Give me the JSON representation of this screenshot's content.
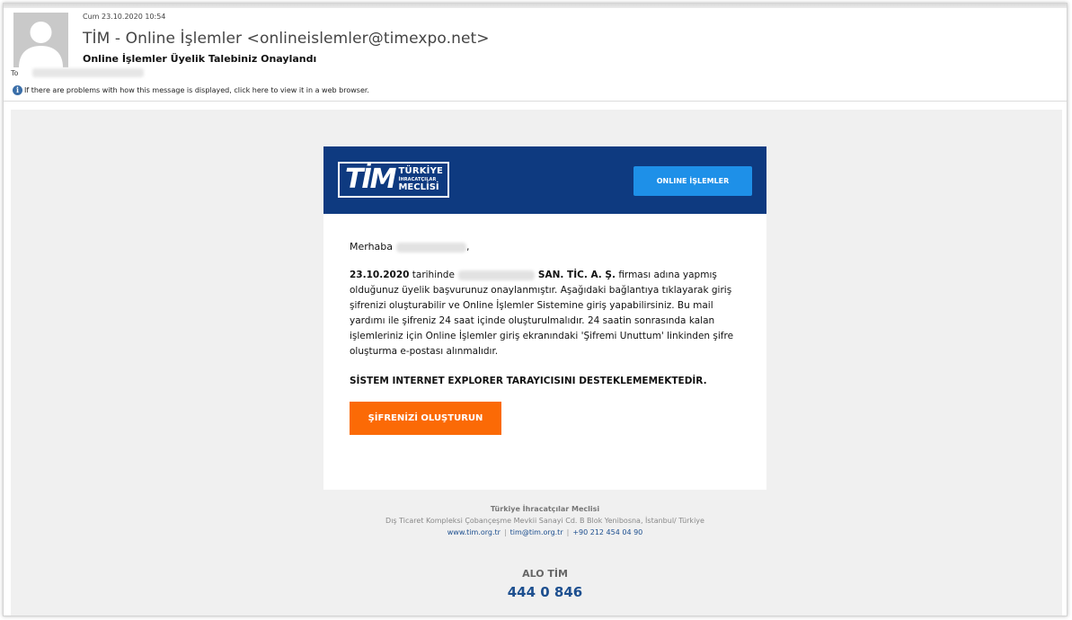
{
  "header": {
    "date": "Cum 23.10.2020 10:54",
    "sender": "TİM - Online İşlemler <onlineislemler@timexpo.net>",
    "subject": "Online İşlemler Üyelik Talebiniz Onaylandı",
    "to_label": "To",
    "info_icon": "info-icon",
    "info_text": "If there are problems with how this message is displayed, click here to view it in a web browser."
  },
  "brand": {
    "logo_mark": "TİM",
    "logo_line1": "TÜRKİYE",
    "logo_line2": "İHRACATÇILAR",
    "logo_line3": "MECLİSİ",
    "online_button": "ONLINE İŞLEMLER",
    "header_color": "#0e3a80",
    "button_color": "#1e90e8",
    "cta_color": "#fb6a06"
  },
  "message": {
    "greeting_prefix": "Merhaba",
    "greeting_suffix": ",",
    "date_bold": "23.10.2020",
    "text_after_date": " tarihinde",
    "company_suffix_bold": "SAN. TİC. A. Ş.",
    "body_text": " firması adına yapmış olduğunuz üyelik başvurunuz onaylanmıştır. Aşağıdaki bağlantıya tıklayarak giriş şifrenizi oluşturabilir ve Online İşlemler Sistemine giriş yapabilirsiniz. Bu mail yardımı ile şifreniz 24 saat içinde oluşturulmalıdır. 24 saatin sonrasında kalan işlemleriniz için Online İşlemler giriş ekranındaki 'Şifremi Unuttum' linkinden şifre oluşturma e-postası alınmalıdır.",
    "warning": "SİSTEM INTERNET EXPLORER TARAYICISINI DESTEKLEMEMEKTEDİR.",
    "cta_label": "ŞİFRENİZİ OLUŞTURUN"
  },
  "footer": {
    "org": "Türkiye İhracatçılar Meclisi",
    "address": "Dış Ticaret Kompleksi Çobançeşme Mevkii Sanayi Cd. B Blok Yenibosna, İstanbul/ Türkiye",
    "website": "www.tim.org.tr",
    "email": "tim@tim.org.tr",
    "phone": "+90 212 454 04 90",
    "separator": "|",
    "alo_title": "ALO TİM",
    "alo_number": "444 0 846"
  }
}
